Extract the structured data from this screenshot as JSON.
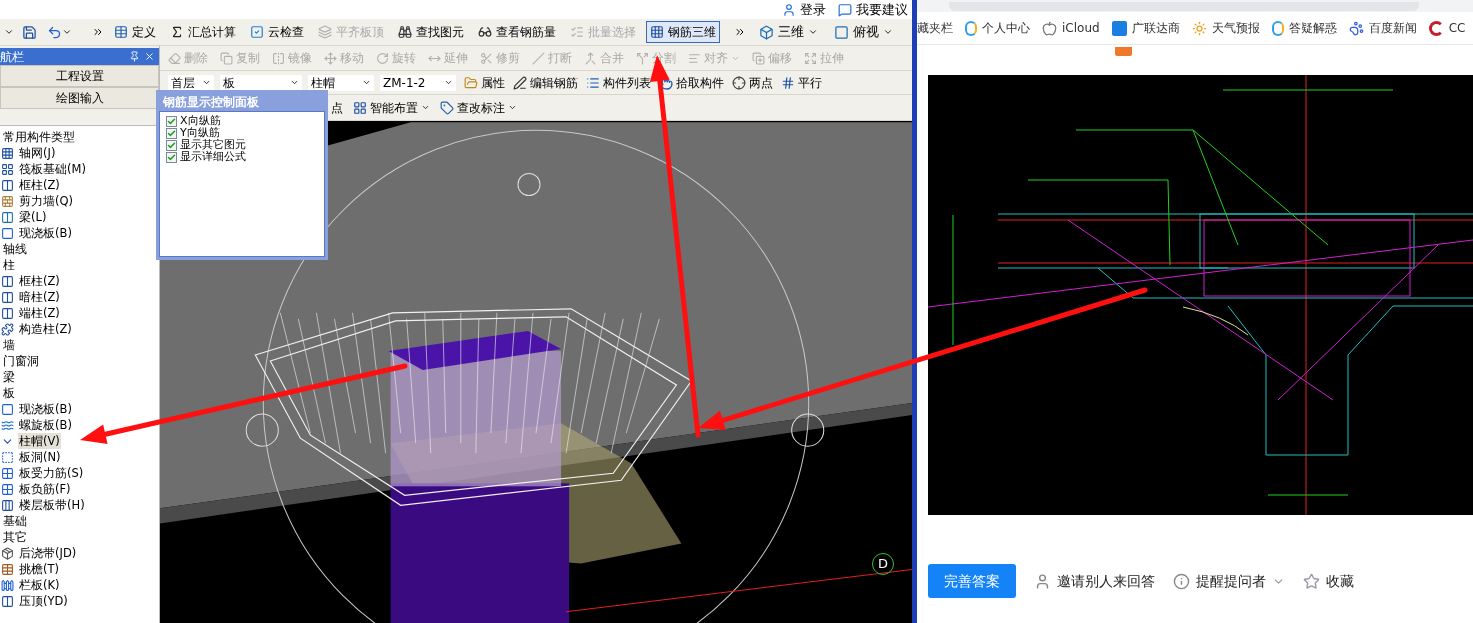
{
  "top_links": [
    "登录",
    "我要建议"
  ],
  "toolbar": [
    {
      "label": "定义",
      "disabled": false,
      "selected": false
    },
    {
      "label": "汇总计算",
      "disabled": false,
      "selected": false
    },
    {
      "label": "云检查",
      "disabled": false,
      "selected": false
    },
    {
      "label": "平齐板顶",
      "disabled": true,
      "selected": false
    },
    {
      "label": "查找图元",
      "disabled": false,
      "selected": false
    },
    {
      "label": "查看钢筋量",
      "disabled": false,
      "selected": false
    },
    {
      "label": "批量选择",
      "disabled": true,
      "selected": false
    },
    {
      "label": "钢筋三维",
      "disabled": false,
      "selected": true
    }
  ],
  "view_menu": [
    "三维",
    "俯视"
  ],
  "nav": {
    "title": "航栏",
    "buttons": [
      "工程设置",
      "绘图输入"
    ],
    "tree": [
      {
        "label": "常用构件类型",
        "kind": "category",
        "selected": false
      },
      {
        "label": "轴网(J)",
        "kind": "item",
        "selected": false
      },
      {
        "label": "筏板基础(M)",
        "kind": "item",
        "selected": false
      },
      {
        "label": "框柱(Z)",
        "kind": "item",
        "selected": false
      },
      {
        "label": "剪力墙(Q)",
        "kind": "item",
        "selected": false
      },
      {
        "label": "梁(L)",
        "kind": "item",
        "selected": false
      },
      {
        "label": "现浇板(B)",
        "kind": "item",
        "selected": false
      },
      {
        "label": "轴线",
        "kind": "category",
        "selected": false
      },
      {
        "label": "柱",
        "kind": "category",
        "selected": false
      },
      {
        "label": "框柱(Z)",
        "kind": "item",
        "selected": false
      },
      {
        "label": "暗柱(Z)",
        "kind": "item",
        "selected": false
      },
      {
        "label": "端柱(Z)",
        "kind": "item",
        "selected": false
      },
      {
        "label": "构造柱(Z)",
        "kind": "item",
        "selected": false
      },
      {
        "label": "墙",
        "kind": "category",
        "selected": false
      },
      {
        "label": "门窗洞",
        "kind": "category",
        "selected": false
      },
      {
        "label": "梁",
        "kind": "category",
        "selected": false
      },
      {
        "label": "板",
        "kind": "category",
        "selected": false
      },
      {
        "label": "现浇板(B)",
        "kind": "item",
        "selected": false
      },
      {
        "label": "螺旋板(B)",
        "kind": "item",
        "selected": false
      },
      {
        "label": "柱帽(V)",
        "kind": "item",
        "selected": true
      },
      {
        "label": "板洞(N)",
        "kind": "item",
        "selected": false
      },
      {
        "label": "板受力筋(S)",
        "kind": "item",
        "selected": false
      },
      {
        "label": "板负筋(F)",
        "kind": "item",
        "selected": false
      },
      {
        "label": "楼层板带(H)",
        "kind": "item",
        "selected": false
      },
      {
        "label": "基础",
        "kind": "category",
        "selected": false
      },
      {
        "label": "其它",
        "kind": "category",
        "selected": false
      },
      {
        "label": "后浇带(JD)",
        "kind": "item",
        "selected": false
      },
      {
        "label": "挑檐(T)",
        "kind": "item",
        "selected": false
      },
      {
        "label": "栏板(K)",
        "kind": "item",
        "selected": false
      },
      {
        "label": "压顶(YD)",
        "kind": "item",
        "selected": false
      }
    ]
  },
  "edit_toolbar": [
    {
      "label": "删除",
      "disabled": true,
      "dropdown": false
    },
    {
      "label": "复制",
      "disabled": true,
      "dropdown": false
    },
    {
      "label": "镜像",
      "disabled": true,
      "dropdown": false
    },
    {
      "label": "移动",
      "disabled": true,
      "dropdown": false
    },
    {
      "label": "旋转",
      "disabled": true,
      "dropdown": false
    },
    {
      "label": "延伸",
      "disabled": true,
      "dropdown": false
    },
    {
      "label": "修剪",
      "disabled": true,
      "dropdown": false
    },
    {
      "label": "打断",
      "disabled": true,
      "dropdown": false
    },
    {
      "label": "合并",
      "disabled": true,
      "dropdown": false
    },
    {
      "label": "分割",
      "disabled": true,
      "dropdown": false
    },
    {
      "label": "对齐",
      "disabled": true,
      "dropdown": true
    },
    {
      "label": "偏移",
      "disabled": true,
      "dropdown": false
    },
    {
      "label": "拉伸",
      "disabled": true,
      "dropdown": false
    }
  ],
  "selectors": [
    "首层",
    "板",
    "柱帽",
    "ZM-1-2"
  ],
  "component_tools": [
    "属性",
    "编辑钢筋",
    "构件列表",
    "拾取构件",
    "两点",
    "平行"
  ],
  "layout_tools": [
    {
      "label": "点",
      "dropdown": false
    },
    {
      "label": "智能布置",
      "dropdown": true
    },
    {
      "label": "查改标注",
      "dropdown": true
    }
  ],
  "panel": {
    "title": "钢筋显示控制面板",
    "options": [
      {
        "label": "X向纵筋",
        "checked": true
      },
      {
        "label": "Y向纵筋",
        "checked": true
      },
      {
        "label": "显示其它图元",
        "checked": true
      },
      {
        "label": "显示详细公式",
        "checked": true
      }
    ]
  },
  "view": {
    "marker": "D"
  },
  "browser": {
    "bookmarks": [
      "藏夹栏",
      "个人中心",
      "iCloud",
      "广联达商",
      "天气预报",
      "答疑解惑",
      "百度新闻",
      "CC"
    ],
    "primary": "完善答案",
    "actions": [
      {
        "label": "邀请别人来回答",
        "dropdown": false
      },
      {
        "label": "提醒提问者",
        "dropdown": true
      },
      {
        "label": "收藏",
        "dropdown": false
      }
    ]
  }
}
